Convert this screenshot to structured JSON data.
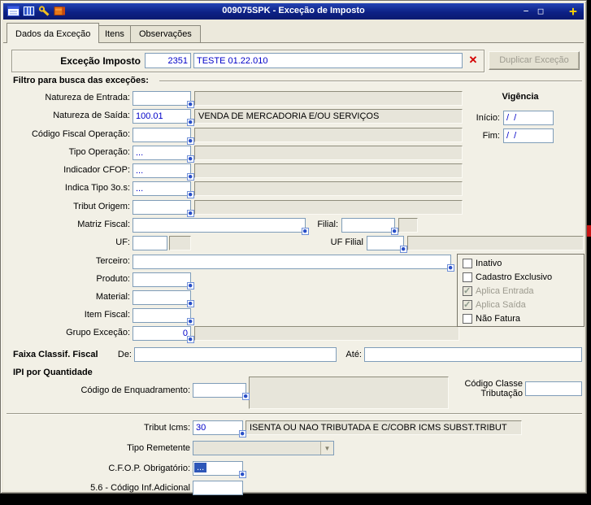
{
  "window": {
    "title": "009075SPK - Exceção de Imposto",
    "controls": {
      "minimize": "−",
      "maximize": "□",
      "plus": "+"
    }
  },
  "tabs": [
    {
      "label": "Dados da Exceção"
    },
    {
      "label": "Itens"
    },
    {
      "label": "Observações"
    }
  ],
  "header": {
    "label": "Exceção Imposto",
    "code": "2351",
    "description": "TESTE 01.22.010",
    "duplicate_button": "Duplicar Exceção"
  },
  "filter": {
    "title": "Filtro para busca das exceções:",
    "natureza_entrada": {
      "label": "Natureza de Entrada:",
      "value": "",
      "desc": ""
    },
    "natureza_saida": {
      "label": "Natureza de Saída:",
      "value": "100.01",
      "desc": "VENDA DE MERCADORIA E/OU SERVIÇOS"
    },
    "codigo_fiscal_operacao": {
      "label": "Código Fiscal Operação:",
      "value": "",
      "desc": ""
    },
    "tipo_operacao": {
      "label": "Tipo Operação:",
      "value": "...",
      "desc": ""
    },
    "indicador_cfop": {
      "label": "Indicador CFOP:",
      "value": "...",
      "desc": ""
    },
    "indica_tipo_3os": {
      "label": "Indica Tipo 3o.s:",
      "value": "...",
      "desc": ""
    },
    "tribut_origem": {
      "label": "Tribut Origem:",
      "value": "",
      "desc": ""
    },
    "matriz_fiscal": {
      "label": "Matriz Fiscal:",
      "value": ""
    },
    "filial": {
      "label": "Filial:",
      "value": "",
      "desc": ""
    },
    "uf": {
      "label": "UF:",
      "value": "",
      "desc": ""
    },
    "uf_filial": {
      "label": "UF Filial",
      "value": "",
      "desc": ""
    },
    "terceiro": {
      "label": "Terceiro:",
      "value": ""
    },
    "produto": {
      "label": "Produto:",
      "value": ""
    },
    "material": {
      "label": "Material:",
      "value": ""
    },
    "item_fiscal": {
      "label": "Item Fiscal:",
      "value": ""
    },
    "grupo_excecao": {
      "label": "Grupo Exceção:",
      "value": "0",
      "desc": ""
    }
  },
  "vigencia": {
    "title": "Vigência",
    "inicio": {
      "label": "Início:",
      "value": "/  /"
    },
    "fim": {
      "label": "Fim:",
      "value": "/  /"
    }
  },
  "options": [
    {
      "label": "Inativo",
      "checked": false,
      "disabled": false
    },
    {
      "label": "Cadastro Exclusivo",
      "checked": false,
      "disabled": false
    },
    {
      "label": "Aplica Entrada",
      "checked": true,
      "disabled": true
    },
    {
      "label": "Aplica Saída",
      "checked": true,
      "disabled": true
    },
    {
      "label": "Não Fatura",
      "checked": false,
      "disabled": false
    }
  ],
  "faixa": {
    "title": "Faixa Classif. Fiscal",
    "de_label": "De:",
    "de_value": "",
    "ate_label": "Até:",
    "ate_value": ""
  },
  "ipi": {
    "title": "IPI por Quantidade",
    "cod_enquadramento": {
      "label": "Código de Enquadramento:",
      "value": "",
      "desc": ""
    },
    "cod_classe": {
      "label": "Código Classe Tributação",
      "value": ""
    }
  },
  "tributacao": {
    "tribut_icms": {
      "label": "Tribut Icms:",
      "value": "30",
      "desc": "ISENTA OU NAO TRIBUTADA E C/COBR ICMS SUBST.TRIBUT"
    },
    "tipo_remetente": {
      "label": "Tipo Remetente",
      "value": ""
    },
    "cfop_obrigatorio": {
      "label": "C.F.O.P. Obrigatório:",
      "value": "..."
    },
    "cod_inf_adicional": {
      "label": "5.6 - Código Inf.Adicional",
      "value": ""
    }
  }
}
